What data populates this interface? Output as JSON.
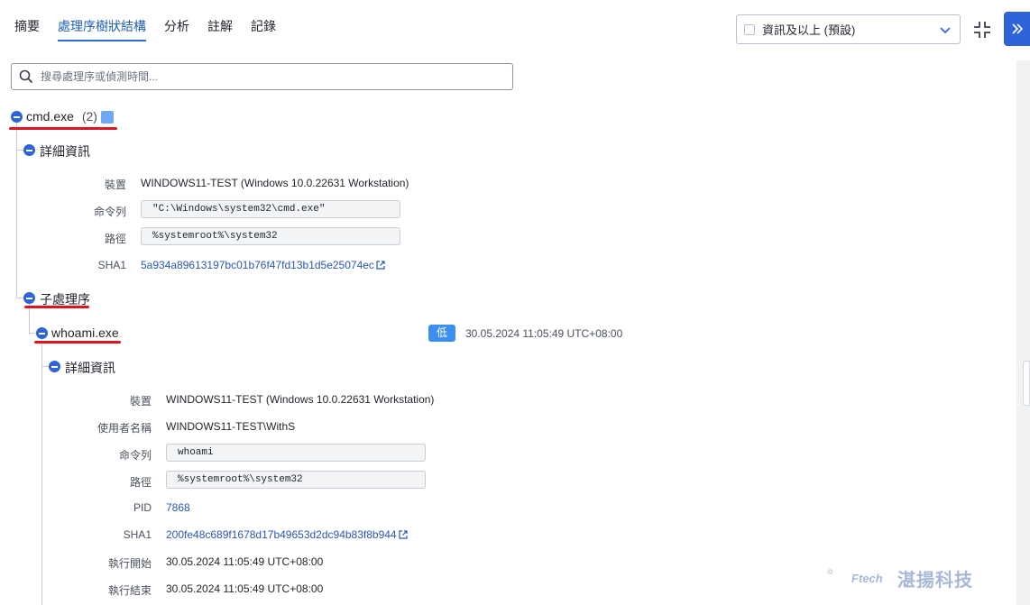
{
  "tabs": [
    "摘要",
    "處理序樹狀結構",
    "分析",
    "註解",
    "記錄"
  ],
  "filter": {
    "value": "資訊及以上 (預設)"
  },
  "search": {
    "placeholder": "搜尋處理序或偵測時間..."
  },
  "root": {
    "name": "cmd.exe",
    "count": "(2)",
    "details_label": "詳細資訊",
    "details": {
      "device_key": "裝置",
      "device_val": "WINDOWS11-TEST (Windows 10.0.22631 Workstation)",
      "cmd_key": "命令列",
      "cmd_val": "\"C:\\Windows\\system32\\cmd.exe\"",
      "path_key": "路徑",
      "path_val": "%systemroot%\\system32",
      "sha1_key": "SHA1",
      "sha1_val": "5a934a89613197bc01b76f47fd13b1d5e25074ec"
    }
  },
  "children_label": "子處理序",
  "child": {
    "name": "whoami.exe",
    "severity": "低",
    "timestamp": "30.05.2024 11:05:49 UTC+08:00",
    "details_label": "詳細資訊",
    "details": {
      "device_key": "裝置",
      "device_val": "WINDOWS11-TEST (Windows 10.0.22631 Workstation)",
      "user_key": "使用者名稱",
      "user_val": "WINDOWS11-TEST\\WithS",
      "cmd_key": "命令列",
      "cmd_val": "whoami",
      "path_key": "路徑",
      "path_val": "%systemroot%\\system32",
      "pid_key": "PID",
      "pid_val": "7868",
      "sha1_key": "SHA1",
      "sha1_val": "200fe48c689f1678d17b49653d2dc94b83f8b944",
      "start_key": "執行開始",
      "start_val": "30.05.2024 11:05:49 UTC+08:00",
      "end_key": "執行結束",
      "end_val": "30.05.2024 11:05:49 UTC+08:00"
    }
  },
  "watermark": {
    "brand_small": "Ftech",
    "brand_cn": "湛揚科技"
  },
  "colors": {
    "accent": "#2f63d8",
    "badge": "#3c8ff0",
    "process_color": "#6ea8f7",
    "highlight": "#e0141e"
  }
}
